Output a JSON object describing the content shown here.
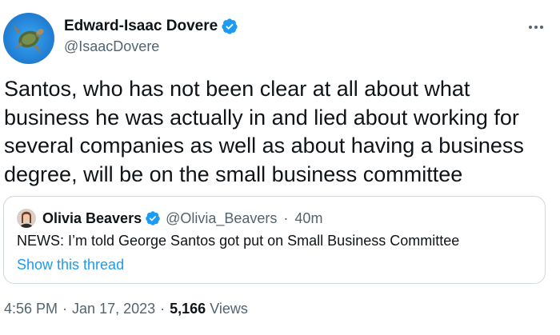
{
  "author": {
    "display_name": "Edward-Isaac Dovere",
    "handle": "@IsaacDovere",
    "verified": true,
    "avatar_icon": "avatar-image"
  },
  "tweet": {
    "text": "Santos, who has not been clear at all about what business he was actually in and lied about working for several companies as well as about having a business degree, will be on the small business committee"
  },
  "quote": {
    "display_name": "Olivia Beavers",
    "handle": "@Olivia_Beavers",
    "separator": "·",
    "time": "40m",
    "text": "NEWS: I’m told George Santos got put on Small Business Committee",
    "show_thread": "Show this thread"
  },
  "meta": {
    "time": "4:56 PM",
    "separator": "·",
    "date": "Jan 17, 2023",
    "views_count": "5,166",
    "views_label": "Views"
  },
  "colors": {
    "text": "#0f1419",
    "secondary": "#536471",
    "link": "#1d9bf0",
    "verified": "#1d9bf0",
    "border": "#cfd9de"
  },
  "icons": {
    "more": "more-options-icon",
    "verified": "verified-badge-icon"
  }
}
